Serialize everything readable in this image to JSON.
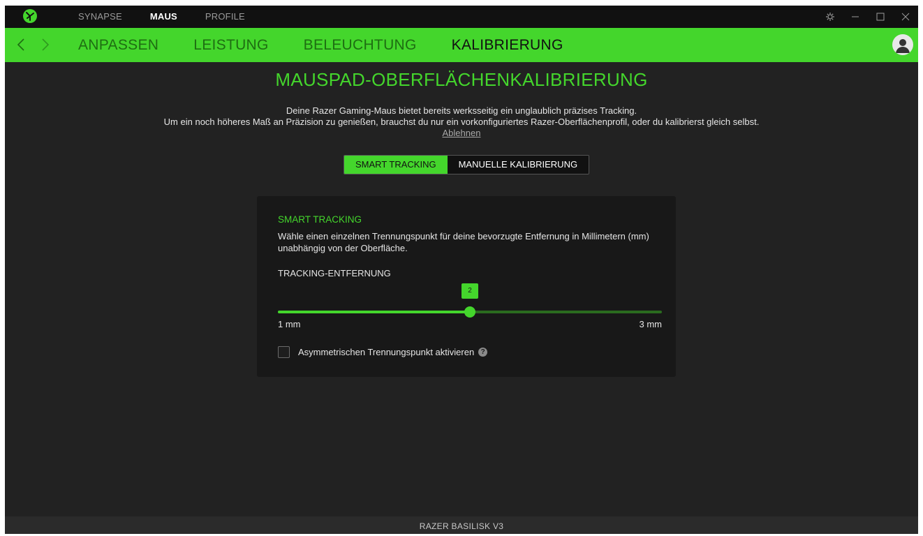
{
  "titlebar": {
    "nav": [
      "SYNAPSE",
      "MAUS",
      "PROFILE"
    ],
    "active_nav": "MAUS"
  },
  "subnav": {
    "tabs": [
      "ANPASSEN",
      "LEISTUNG",
      "BELEUCHTUNG",
      "KALIBRIERUNG"
    ],
    "active_tab": "KALIBRIERUNG"
  },
  "main": {
    "title": "MAUSPAD-OBERFLÄCHENKALIBRIERUNG",
    "desc_line1": "Deine Razer Gaming-Maus bietet bereits werksseitig ein unglaublich präzises Tracking.",
    "desc_line2": "Um ein noch höheres Maß an Präzision zu genießen, brauchst du nur ein vorkonfiguriertes Razer-Oberflächenprofil,  oder du kalibrierst gleich selbst.",
    "decline_link": "Ablehnen",
    "mode_options": [
      "SMART TRACKING",
      "MANUELLE KALIBRIERUNG"
    ],
    "active_mode": "SMART TRACKING"
  },
  "card": {
    "title": "SMART TRACKING",
    "description": "Wähle einen einzelnen Trennungspunkt für deine bevorzugte Entfernung in Millimetern (mm) unabhängig von der Oberfläche.",
    "slider_label": "TRACKING-ENTFERNUNG",
    "slider": {
      "min": 1,
      "max": 3,
      "value": 2,
      "value_text": "2",
      "min_label": "1 mm",
      "max_label": "3 mm"
    },
    "checkbox_label": "Asymmetrischen Trennungspunkt aktivieren",
    "checkbox_checked": false,
    "help_glyph": "?"
  },
  "footer": {
    "device": "RAZER BASILISK V3"
  },
  "colors": {
    "accent": "#44d62c",
    "background": "#222222",
    "titlebar": "#111111"
  }
}
